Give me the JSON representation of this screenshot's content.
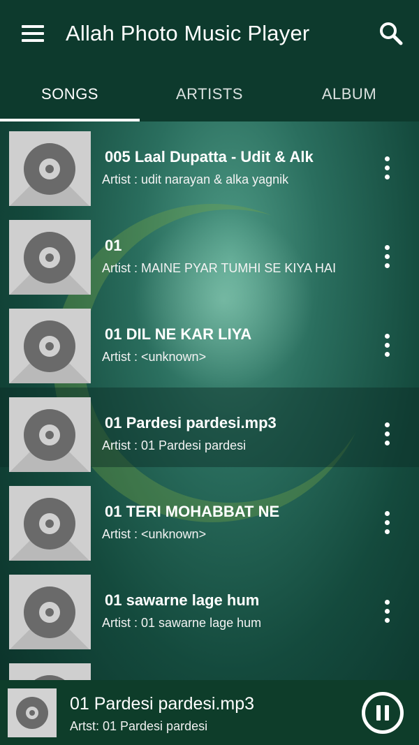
{
  "header": {
    "title": "Allah Photo Music Player",
    "menu_icon": "hamburger-menu-icon",
    "search_icon": "search-icon"
  },
  "tabs": [
    {
      "label": "SONGS",
      "active": true
    },
    {
      "label": "ARTISTS",
      "active": false
    },
    {
      "label": "ALBUM",
      "active": false
    }
  ],
  "songs": [
    {
      "title": "005 Laal Dupatta - Udit & Alk",
      "artist": "Artist : udit narayan & alka yagnik"
    },
    {
      "title": "01",
      "artist": "Artist : MAINE PYAR TUMHI SE KIYA HAI"
    },
    {
      "title": "01 DIL NE KAR LIYA",
      "artist": "Artist : <unknown>"
    },
    {
      "title": "01 Pardesi pardesi.mp3",
      "artist": "Artist : 01 Pardesi pardesi",
      "highlighted": true
    },
    {
      "title": "01 TERI MOHABBAT NE",
      "artist": "Artist : <unknown>"
    },
    {
      "title": "01 sawarne lage hum",
      "artist": "Artist : 01 sawarne lage hum"
    }
  ],
  "now_playing": {
    "title": "01 Pardesi pardesi.mp3",
    "artist": "Artst: 01 Pardesi pardesi",
    "control_icon": "pause-icon"
  },
  "colors": {
    "app_bar": "#0d3a2d",
    "now_playing_bar": "#0e3d2a",
    "accent": "#ffffff"
  }
}
